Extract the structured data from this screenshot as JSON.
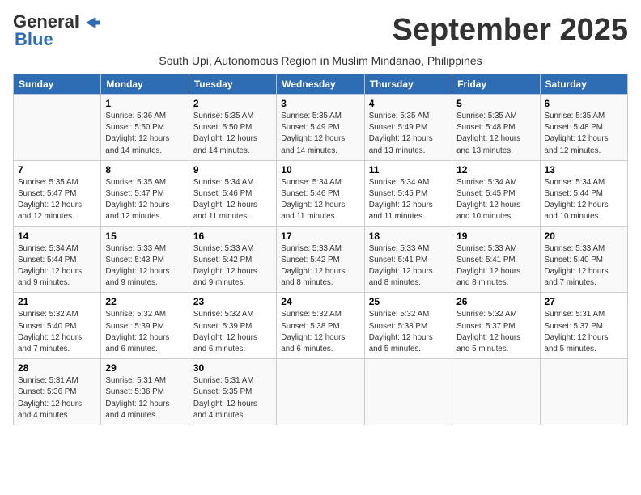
{
  "header": {
    "logo_general": "General",
    "logo_blue": "Blue",
    "month_title": "September 2025",
    "subtitle": "South Upi, Autonomous Region in Muslim Mindanao, Philippines"
  },
  "weekdays": [
    "Sunday",
    "Monday",
    "Tuesday",
    "Wednesday",
    "Thursday",
    "Friday",
    "Saturday"
  ],
  "weeks": [
    [
      {
        "day": "",
        "text": ""
      },
      {
        "day": "1",
        "text": "Sunrise: 5:36 AM\nSunset: 5:50 PM\nDaylight: 12 hours\nand 14 minutes."
      },
      {
        "day": "2",
        "text": "Sunrise: 5:35 AM\nSunset: 5:50 PM\nDaylight: 12 hours\nand 14 minutes."
      },
      {
        "day": "3",
        "text": "Sunrise: 5:35 AM\nSunset: 5:49 PM\nDaylight: 12 hours\nand 14 minutes."
      },
      {
        "day": "4",
        "text": "Sunrise: 5:35 AM\nSunset: 5:49 PM\nDaylight: 12 hours\nand 13 minutes."
      },
      {
        "day": "5",
        "text": "Sunrise: 5:35 AM\nSunset: 5:48 PM\nDaylight: 12 hours\nand 13 minutes."
      },
      {
        "day": "6",
        "text": "Sunrise: 5:35 AM\nSunset: 5:48 PM\nDaylight: 12 hours\nand 12 minutes."
      }
    ],
    [
      {
        "day": "7",
        "text": "Sunrise: 5:35 AM\nSunset: 5:47 PM\nDaylight: 12 hours\nand 12 minutes."
      },
      {
        "day": "8",
        "text": "Sunrise: 5:35 AM\nSunset: 5:47 PM\nDaylight: 12 hours\nand 12 minutes."
      },
      {
        "day": "9",
        "text": "Sunrise: 5:34 AM\nSunset: 5:46 PM\nDaylight: 12 hours\nand 11 minutes."
      },
      {
        "day": "10",
        "text": "Sunrise: 5:34 AM\nSunset: 5:46 PM\nDaylight: 12 hours\nand 11 minutes."
      },
      {
        "day": "11",
        "text": "Sunrise: 5:34 AM\nSunset: 5:45 PM\nDaylight: 12 hours\nand 11 minutes."
      },
      {
        "day": "12",
        "text": "Sunrise: 5:34 AM\nSunset: 5:45 PM\nDaylight: 12 hours\nand 10 minutes."
      },
      {
        "day": "13",
        "text": "Sunrise: 5:34 AM\nSunset: 5:44 PM\nDaylight: 12 hours\nand 10 minutes."
      }
    ],
    [
      {
        "day": "14",
        "text": "Sunrise: 5:34 AM\nSunset: 5:44 PM\nDaylight: 12 hours\nand 9 minutes."
      },
      {
        "day": "15",
        "text": "Sunrise: 5:33 AM\nSunset: 5:43 PM\nDaylight: 12 hours\nand 9 minutes."
      },
      {
        "day": "16",
        "text": "Sunrise: 5:33 AM\nSunset: 5:42 PM\nDaylight: 12 hours\nand 9 minutes."
      },
      {
        "day": "17",
        "text": "Sunrise: 5:33 AM\nSunset: 5:42 PM\nDaylight: 12 hours\nand 8 minutes."
      },
      {
        "day": "18",
        "text": "Sunrise: 5:33 AM\nSunset: 5:41 PM\nDaylight: 12 hours\nand 8 minutes."
      },
      {
        "day": "19",
        "text": "Sunrise: 5:33 AM\nSunset: 5:41 PM\nDaylight: 12 hours\nand 8 minutes."
      },
      {
        "day": "20",
        "text": "Sunrise: 5:33 AM\nSunset: 5:40 PM\nDaylight: 12 hours\nand 7 minutes."
      }
    ],
    [
      {
        "day": "21",
        "text": "Sunrise: 5:32 AM\nSunset: 5:40 PM\nDaylight: 12 hours\nand 7 minutes."
      },
      {
        "day": "22",
        "text": "Sunrise: 5:32 AM\nSunset: 5:39 PM\nDaylight: 12 hours\nand 6 minutes."
      },
      {
        "day": "23",
        "text": "Sunrise: 5:32 AM\nSunset: 5:39 PM\nDaylight: 12 hours\nand 6 minutes."
      },
      {
        "day": "24",
        "text": "Sunrise: 5:32 AM\nSunset: 5:38 PM\nDaylight: 12 hours\nand 6 minutes."
      },
      {
        "day": "25",
        "text": "Sunrise: 5:32 AM\nSunset: 5:38 PM\nDaylight: 12 hours\nand 5 minutes."
      },
      {
        "day": "26",
        "text": "Sunrise: 5:32 AM\nSunset: 5:37 PM\nDaylight: 12 hours\nand 5 minutes."
      },
      {
        "day": "27",
        "text": "Sunrise: 5:31 AM\nSunset: 5:37 PM\nDaylight: 12 hours\nand 5 minutes."
      }
    ],
    [
      {
        "day": "28",
        "text": "Sunrise: 5:31 AM\nSunset: 5:36 PM\nDaylight: 12 hours\nand 4 minutes."
      },
      {
        "day": "29",
        "text": "Sunrise: 5:31 AM\nSunset: 5:36 PM\nDaylight: 12 hours\nand 4 minutes."
      },
      {
        "day": "30",
        "text": "Sunrise: 5:31 AM\nSunset: 5:35 PM\nDaylight: 12 hours\nand 4 minutes."
      },
      {
        "day": "",
        "text": ""
      },
      {
        "day": "",
        "text": ""
      },
      {
        "day": "",
        "text": ""
      },
      {
        "day": "",
        "text": ""
      }
    ]
  ]
}
